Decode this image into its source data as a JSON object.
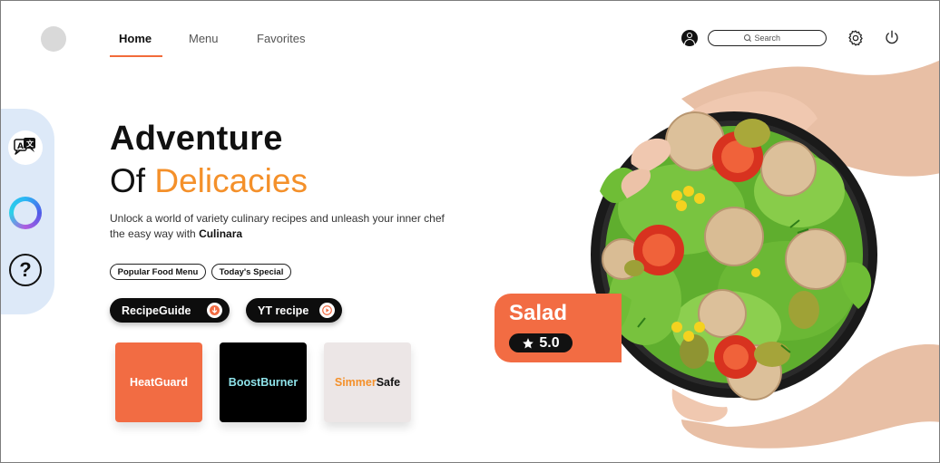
{
  "nav": {
    "items": [
      {
        "label": "Home",
        "active": true
      },
      {
        "label": "Menu",
        "active": false
      },
      {
        "label": "Favorites",
        "active": false
      }
    ]
  },
  "header": {
    "search_placeholder": "Search",
    "icons": [
      "profile-icon",
      "search-icon",
      "gear-icon",
      "power-icon"
    ]
  },
  "sidebar": {
    "icons": [
      "translate-icon",
      "assistant-ring-icon",
      "help-icon"
    ],
    "help_glyph": "?"
  },
  "hero": {
    "title": "Adventure",
    "subtitle_prefix": "Of",
    "subtitle_accent": "Delicacies",
    "description": "Unlock a world of variety culinary recipes and unleash your inner chef the easy way with",
    "brand": "Culinara"
  },
  "chips": [
    "Popular Food Menu",
    "Today's Special"
  ],
  "buttons": {
    "recipe_guide": "RecipeGuide",
    "yt_recipe": "YT recipe"
  },
  "cards": [
    {
      "label": "HeatGuard"
    },
    {
      "label": "BoostBurner"
    },
    {
      "label_accent": "Simmer",
      "label_rest": "Safe"
    }
  ],
  "feature": {
    "name": "Salad",
    "rating": "5.0"
  },
  "colors": {
    "accent_orange": "#f26c43",
    "highlight_orange": "#f4902a",
    "sidebar_bg": "#dde9f8",
    "dark": "#0d0d0d"
  }
}
